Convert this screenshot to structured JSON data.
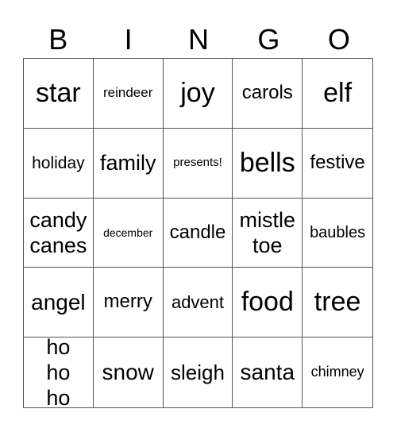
{
  "header": [
    "B",
    "I",
    "N",
    "G",
    "O"
  ],
  "cells": [
    "star",
    "reindeer",
    "joy",
    "carols",
    "elf",
    "holiday",
    "family",
    "presents!",
    "bells",
    "festive",
    "candy canes",
    "december",
    "candle",
    "mistle toe",
    "baubles",
    "angel",
    "merry",
    "advent",
    "food",
    "tree",
    "ho ho ho",
    "snow",
    "sleigh",
    "santa",
    "chimney"
  ]
}
